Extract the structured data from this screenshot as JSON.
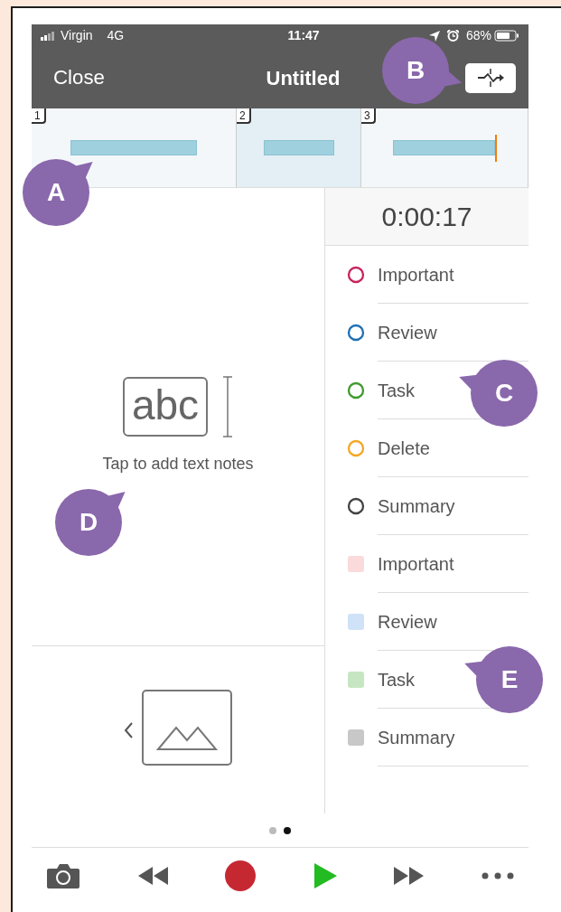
{
  "status_bar": {
    "carrier": "Virgin",
    "network": "4G",
    "time": "11:47",
    "battery": "68%"
  },
  "nav": {
    "close": "Close",
    "title": "Untitled"
  },
  "segments": [
    {
      "number": "1",
      "selected": false,
      "playhead": false
    },
    {
      "number": "2",
      "selected": true,
      "playhead": false
    },
    {
      "number": "3",
      "selected": false,
      "playhead": true
    }
  ],
  "timer": "0:00:17",
  "tags": [
    {
      "kind": "outline",
      "label": "Important",
      "color": "#c8245e"
    },
    {
      "kind": "outline",
      "label": "Review",
      "color": "#1e6fb5"
    },
    {
      "kind": "outline",
      "label": "Task",
      "color": "#3f9a2d"
    },
    {
      "kind": "outline",
      "label": "Delete",
      "color": "#f5a623"
    },
    {
      "kind": "outline",
      "label": "Summary",
      "color": "#444444"
    },
    {
      "kind": "filled",
      "label": "Important",
      "color": "#fadadb"
    },
    {
      "kind": "filled",
      "label": "Review",
      "color": "#cfe2f8"
    },
    {
      "kind": "filled",
      "label": "Task",
      "color": "#c6e6c2"
    },
    {
      "kind": "filled",
      "label": "Summary",
      "color": "#c8c8c8"
    }
  ],
  "notes": {
    "sample": "abc",
    "hint": "Tap to add text notes"
  },
  "pages": [
    {
      "selected": false
    },
    {
      "selected": true
    }
  ],
  "toolbar": [
    {
      "kind": "camera"
    },
    {
      "kind": "rewind"
    },
    {
      "kind": "record"
    },
    {
      "kind": "play"
    },
    {
      "kind": "forward"
    },
    {
      "kind": "more"
    }
  ],
  "callouts": [
    {
      "label": "A"
    },
    {
      "label": "B"
    },
    {
      "label": "C"
    },
    {
      "label": "D"
    },
    {
      "label": "E"
    }
  ]
}
